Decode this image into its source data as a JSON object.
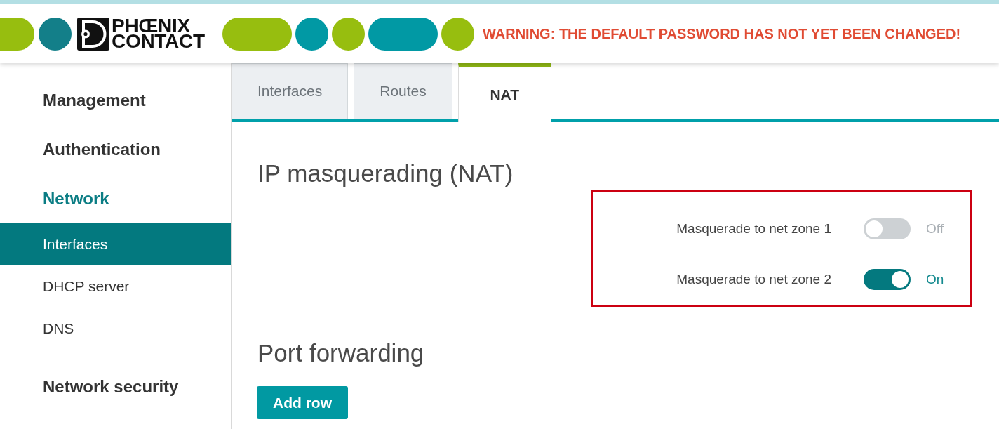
{
  "header": {
    "logo_text": "PHŒNIX CONTACT",
    "warning": "WARNING: THE DEFAULT PASSWORD HAS NOT YET BEEN CHANGED!"
  },
  "sidebar": {
    "items": [
      {
        "label": "Management",
        "selected": false
      },
      {
        "label": "Authentication",
        "selected": false
      },
      {
        "label": "Network",
        "selected": true,
        "children": [
          {
            "label": "Interfaces",
            "selected": true
          },
          {
            "label": "DHCP server",
            "selected": false
          },
          {
            "label": "DNS",
            "selected": false
          }
        ]
      },
      {
        "label": "Network security",
        "selected": false
      }
    ]
  },
  "tabs": [
    {
      "label": "Interfaces",
      "selected": false
    },
    {
      "label": "Routes",
      "selected": false
    },
    {
      "label": "NAT",
      "selected": true
    }
  ],
  "sections": [
    {
      "title": "IP masquerading (NAT)",
      "settings": [
        {
          "label": "Masquerade to net zone 1",
          "on": false,
          "state_text": "Off"
        },
        {
          "label": "Masquerade to net zone 2",
          "on": true,
          "state_text": "On"
        }
      ]
    },
    {
      "title": "Port forwarding",
      "buttons": [
        "Add row"
      ]
    }
  ]
}
